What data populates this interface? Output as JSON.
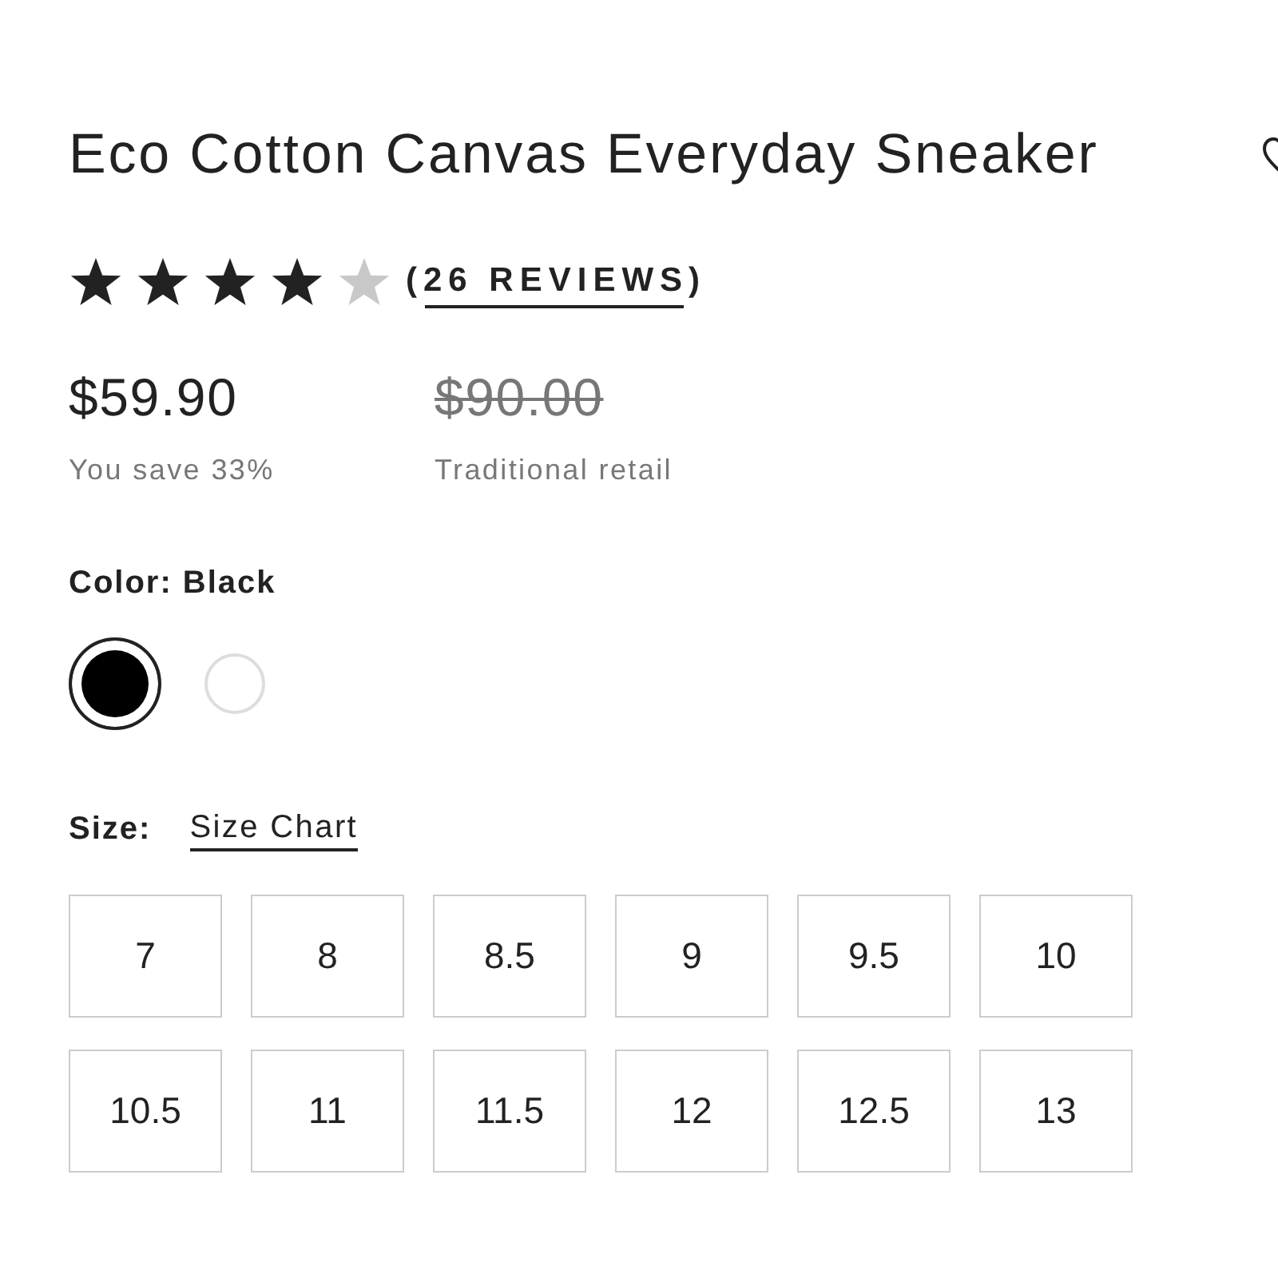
{
  "product": {
    "title": "Eco Cotton Canvas Everyday Sneaker"
  },
  "rating": {
    "stars": 4,
    "reviews": "(26 REVIEWS)"
  },
  "pricing": {
    "price": "$59.90",
    "savings": "You save 33%",
    "original_price": "$90.00",
    "original_label": "Traditional retail"
  },
  "color": {
    "label": "Color: Black",
    "swatches": [
      {
        "color": "#000000",
        "selected": true
      },
      {
        "color": "#ffffff",
        "selected": false
      }
    ]
  },
  "size": {
    "label": "Size:",
    "chart_link": "Size Chart",
    "options": [
      {
        "label": "7",
        "selected": false
      },
      {
        "label": "8",
        "selected": false
      },
      {
        "label": "8.5",
        "selected": false
      },
      {
        "label": "9",
        "selected": false
      },
      {
        "label": "9.5",
        "selected": false
      },
      {
        "label": "10",
        "selected": false
      },
      {
        "label": "10.5",
        "selected": false
      },
      {
        "label": "11",
        "selected": false
      },
      {
        "label": "11.5",
        "selected": false
      },
      {
        "label": "12",
        "selected": false
      },
      {
        "label": "12.5",
        "selected": false
      },
      {
        "label": "13",
        "selected": false
      }
    ]
  }
}
